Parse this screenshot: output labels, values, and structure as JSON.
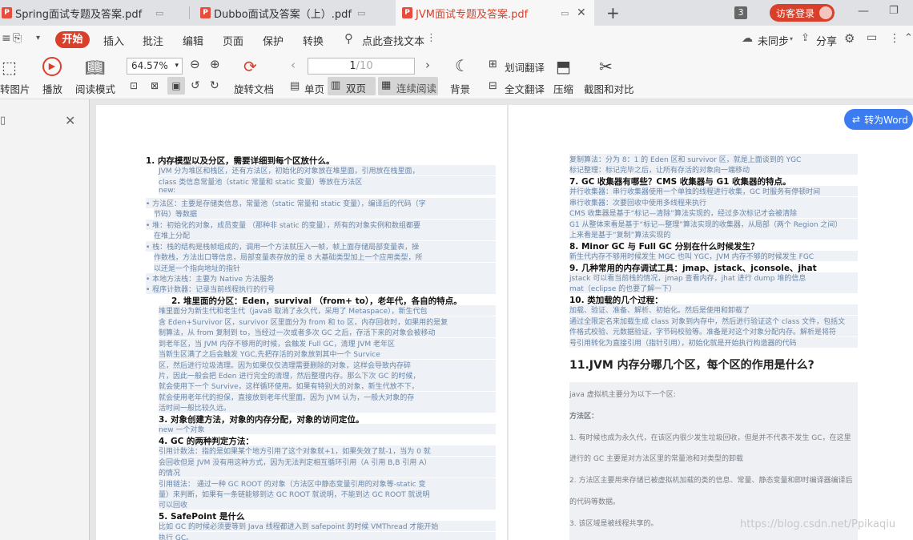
{
  "tabs": [
    {
      "label": "Spring面试专题及答案.pdf"
    },
    {
      "label": "Dubbo面试及答案（上）.pdf"
    },
    {
      "label": "JVM面试专题及答案.pdf"
    }
  ],
  "titlebar": {
    "tab_count": "3",
    "login_label": "访客登录"
  },
  "menu": {
    "start": "开始",
    "items": [
      "插入",
      "批注",
      "编辑",
      "页面",
      "保护",
      "转换"
    ],
    "search": "点此查找文本",
    "sync": "未同步",
    "share": "分享"
  },
  "toolbar": {
    "convert_image": "转图片",
    "play": "播放",
    "read_mode": "阅读模式",
    "zoom": "64.57%",
    "rotate_doc": "旋转文档",
    "page_current": "1",
    "page_total": "/10",
    "single_page": "单页",
    "double_page": "双页",
    "continuous": "连续阅读",
    "background": "背景",
    "word_translate": "划词翻译",
    "full_translate": "全文翻译",
    "compress": "压缩",
    "screenshot_compare": "截图和对比"
  },
  "convert_word": "转为Word",
  "watermark": "https://blog.csdn.net/Ppikaqiu",
  "left_page": [
    {
      "t": "1.  内存模型以及分区，需要详细到每个区放什么。",
      "c": "h"
    },
    {
      "t": "JVM  分为堆区和栈区，还有方法区，初始化的对象放在堆里面，引用放在栈里面，",
      "c": "b",
      "x": 16
    },
    {
      "t": "class 类信息常量池（static 常量和 static 变量）等放在方法区",
      "c": "b",
      "x": 16
    },
    {
      "t": "new:",
      "c": "b",
      "x": 16
    },
    {
      "t": "•  方法区：主要是存储类信息，常量池（static 常量和 static 变量），编译后的代码（字",
      "c": "b",
      "x": 0
    },
    {
      "t": "   节码）等数据",
      "c": "b",
      "x": 10
    },
    {
      "t": "•  堆：初始化的对象，成员变量 （那种非 static 的变量），所有的对象实例和数组都要",
      "c": "b",
      "x": 0
    },
    {
      "t": "   在堆上分配",
      "c": "b",
      "x": 10
    },
    {
      "t": "•  栈：栈的结构是栈帧组成的，调用一个方法就压入一帧，帧上面存储局部变量表，操",
      "c": "b",
      "x": 0
    },
    {
      "t": "   作数栈，方法出口等信息，局部变量表存放的是 8 大基础类型加上一个应用类型，所",
      "c": "b",
      "x": 10
    },
    {
      "t": "   以还是一个指向地址的指针",
      "c": "b",
      "x": 10
    },
    {
      "t": "•  本地方法栈：主要为 Native 方法服务",
      "c": "b",
      "x": 0
    },
    {
      "t": "•  程序计数器：记录当前线程执行的行号",
      "c": "b",
      "x": 0
    },
    {
      "t": "2.  堆里面的分区：Eden，survival （from+ to），老年代，各自的特点。",
      "c": "h",
      "x": 32
    },
    {
      "t": "堆里面分为新生代和老生代（java8 取消了永久代，采用了 Metaspace），新生代包",
      "c": "b",
      "x": 16
    },
    {
      "t": "含 Eden+Survivor 区，survivor 区里面分为 from 和 to 区，内存回收时，如果用的是复",
      "c": "b",
      "x": 16
    },
    {
      "t": "制算法，从 from 复制到 to，当经过一次或者多次 GC 之后，存活下来的对象会被移动",
      "c": "b",
      "x": 16
    },
    {
      "t": "到老年区，当 JVM 内存不够用的时候，会触发 Full GC，清理 JVM 老年区",
      "c": "b",
      "x": 16
    },
    {
      "t": "当新生区满了之后会触发 YGC,先把存活的对象放到其中一个 Survice",
      "c": "b",
      "x": 16
    },
    {
      "t": "区，然后进行垃圾清理。因为如果仅仅清理需要删除的对象，这样会导致内存碎",
      "c": "b",
      "x": 16
    },
    {
      "t": "片，因此一般会把 Eden 进行完全的清理，然后整理内存。那么下次 GC 的时候，",
      "c": "b",
      "x": 16
    },
    {
      "t": "就会使用下一个 Survive，这样循环使用。如果有特别大的对象，新生代放不下，",
      "c": "b",
      "x": 16
    },
    {
      "t": "就会使用老年代的担保，直接放到老年代里面。因为 JVM 认为，一般大对象的存",
      "c": "b",
      "x": 16
    },
    {
      "t": "活时间一般比较久远。",
      "c": "b",
      "x": 16
    },
    {
      "t": "3.  对象创建方法，对象的内存分配，对象的访问定位。",
      "c": "h",
      "x": 16
    },
    {
      "t": "new 一个对象",
      "c": "b",
      "x": 16
    },
    {
      "t": "4.  GC 的两种判定方法：",
      "c": "h",
      "x": 16
    },
    {
      "t": "引用计数法：指的是如果某个地方引用了这个对象就+1，如果失效了就-1，当为 0 就",
      "c": "b",
      "x": 16
    },
    {
      "t": "会回收但是 JVM 没有用这种方式，因为无法判定相互循环引用（A 引用 B,B 引用 A）",
      "c": "b",
      "x": 16
    },
    {
      "t": "的情况",
      "c": "b",
      "x": 16
    },
    {
      "t": "引用链法：  通过一种 GC ROOT 的对象（方法区中静态变量引用的对象等-static 变",
      "c": "b",
      "x": 16
    },
    {
      "t": "量）来判断，如果有一条链能够到达 GC ROOT 就说明，不能到达 GC ROOT 就说明",
      "c": "b",
      "x": 16
    },
    {
      "t": "可以回收",
      "c": "b",
      "x": 16
    },
    {
      "t": "5.  SafePoint 是什么",
      "c": "h",
      "x": 16
    },
    {
      "t": "比如 GC 的时候必须要等到 Java 线程都进入到 safepoint 的时候 VMThread 才能开始",
      "c": "b",
      "x": 16
    },
    {
      "t": "执行 GC。",
      "c": "b",
      "x": 16
    }
  ],
  "right_page": [
    {
      "t": "复制算法：分为 8：1 的 Eden 区和 survivor 区，就是上面谈到的 YGC",
      "c": "b"
    },
    {
      "t": "标记整理：标记完毕之后，让所有存活的对象向一端移动",
      "c": "b"
    },
    {
      "t": "7.  GC 收集器有哪些？CMS 收集器与 G1 收集器的特点。",
      "c": "h"
    },
    {
      "t": "并行收集器：串行收集器使用一个单独的线程进行收集，GC 时服务有停顿时间",
      "c": "b"
    },
    {
      "t": "串行收集器：次要回收中使用多线程来执行",
      "c": "b"
    },
    {
      "t": "CMS 收集器是基于“标记—清除”算法实现的，经过多次标记才会被清除",
      "c": "b"
    },
    {
      "t": "G1 从整体来看是基于“标记—整理”算法实现的收集器，从局部（两个 Region 之间）",
      "c": "b"
    },
    {
      "t": "上来看是基于“复制”算法实现的",
      "c": "b"
    },
    {
      "t": "8.  Minor GC 与 Full GC 分别在什么时候发生？",
      "c": "h"
    },
    {
      "t": "新生代内存不够用时候发生 MGC 也叫 YGC，JVM 内存不够的时候发生 FGC",
      "c": "b"
    },
    {
      "t": "9.  几种常用的内存调试工具：jmap、jstack、jconsole、jhat",
      "c": "h"
    },
    {
      "t": "jstack 可以看当前栈的情况，jmap 查看内存，jhat 进行 dump 堆的信息",
      "c": "b"
    },
    {
      "t": "mat（eclipse 的也要了解一下）",
      "c": "b"
    },
    {
      "t": "10. 类加载的几个过程：",
      "c": "h"
    },
    {
      "t": "加载、验证、准备、解析、初始化。然后是使用和卸载了",
      "c": "b"
    },
    {
      "t": "通过全限定名来加载生成 class 对象到内存中，然后进行验证这个 class 文件，包括文",
      "c": "b"
    },
    {
      "t": "件格式校验、元数据验证，字节码校验等。准备是对这个对象分配内存。解析是将符",
      "c": "b"
    },
    {
      "t": "号引用转化为直接引用（指针引用），初始化就是开始执行构造器的代码",
      "c": "b"
    }
  ],
  "right_section": {
    "title": "11.JVM 内存分哪几个区，每个区的作用是什么?",
    "lines": [
      "java 虚拟机主要分为以下一个区:",
      "方法区：",
      "1. 有时候也成为永久代，在该区内很少发生垃圾回收，但是并不代表不发生 GC，在这里",
      "进行的 GC 主要是对方法区里的常量池和对类型的卸载",
      "2. 方法区主要用来存储已被虚拟机加载的类的信息、常量、静态变量和即时编译器编译后",
      "的代码等数据。",
      "3. 该区域是被线程共享的。"
    ]
  }
}
